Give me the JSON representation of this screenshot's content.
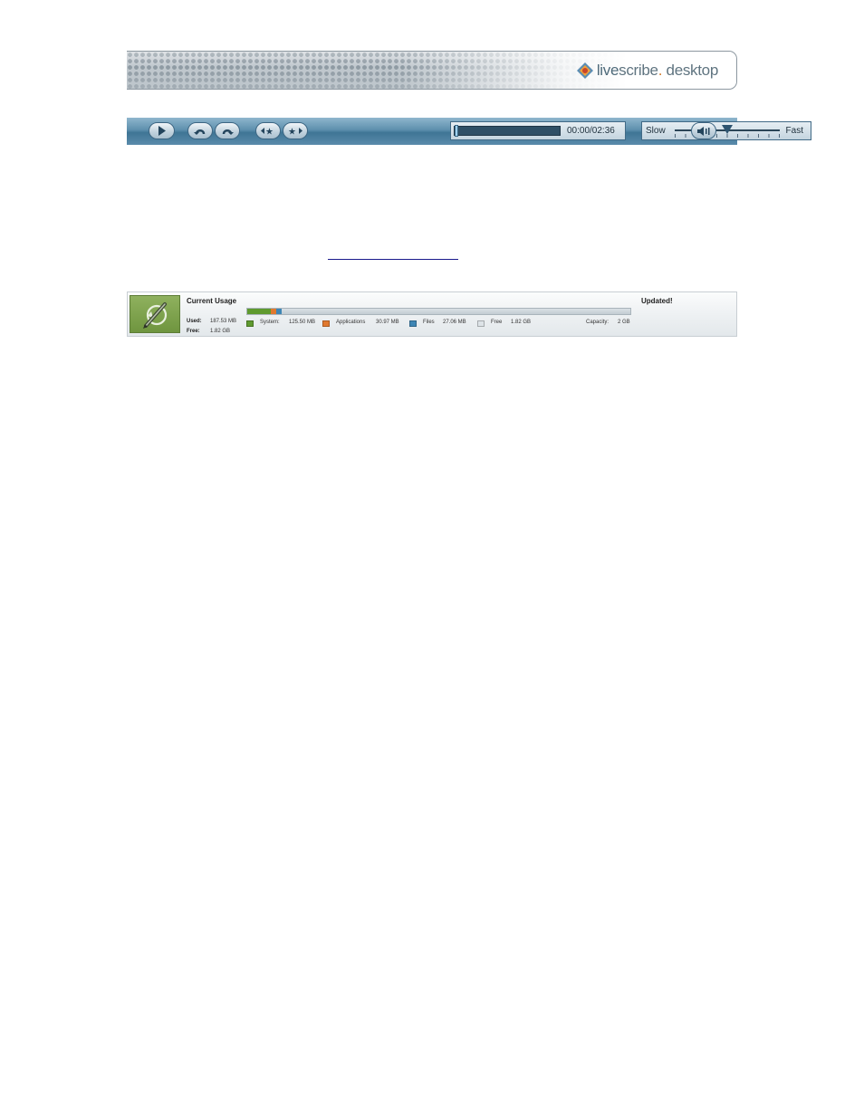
{
  "banner": {
    "logo_live": "live",
    "logo_scribe": "scribe",
    "logo_dot": ".",
    "logo_rest": " desktop"
  },
  "player": {
    "time": "00:00/02:36",
    "progress": 0.0,
    "speed_slow": "Slow",
    "speed_fast": "Fast",
    "speed_level": 0.5,
    "buttons": [
      "play-icon",
      "jump-back-icon",
      "jump-forward-icon",
      "previous-star-icon",
      "next-star-icon"
    ],
    "volume_icon": "volume-icon"
  },
  "usage": {
    "title": "Current Usage",
    "updated": "Updated!",
    "used_label": "Used:",
    "used_value": "187.53 MB",
    "free_label": "Free:",
    "free_value": "1.82 GB",
    "legend": [
      {
        "label": "System:",
        "value": "125.50 MB",
        "color": "#5f9a2f"
      },
      {
        "label": "Applications",
        "value": "30.97 MB",
        "color": "#e0792f"
      },
      {
        "label": "Files",
        "value": "27.06 MB",
        "color": "#3e86b5"
      },
      {
        "label": "Free",
        "value": "1.82 GB",
        "color": "#dde3e7"
      }
    ],
    "capacity_label": "Capacity:",
    "capacity_value": "2 GB",
    "usage_fractions": {
      "system": 0.0613,
      "applications": 0.0151,
      "files": 0.0132
    },
    "icon": "pen-sync-icon"
  }
}
